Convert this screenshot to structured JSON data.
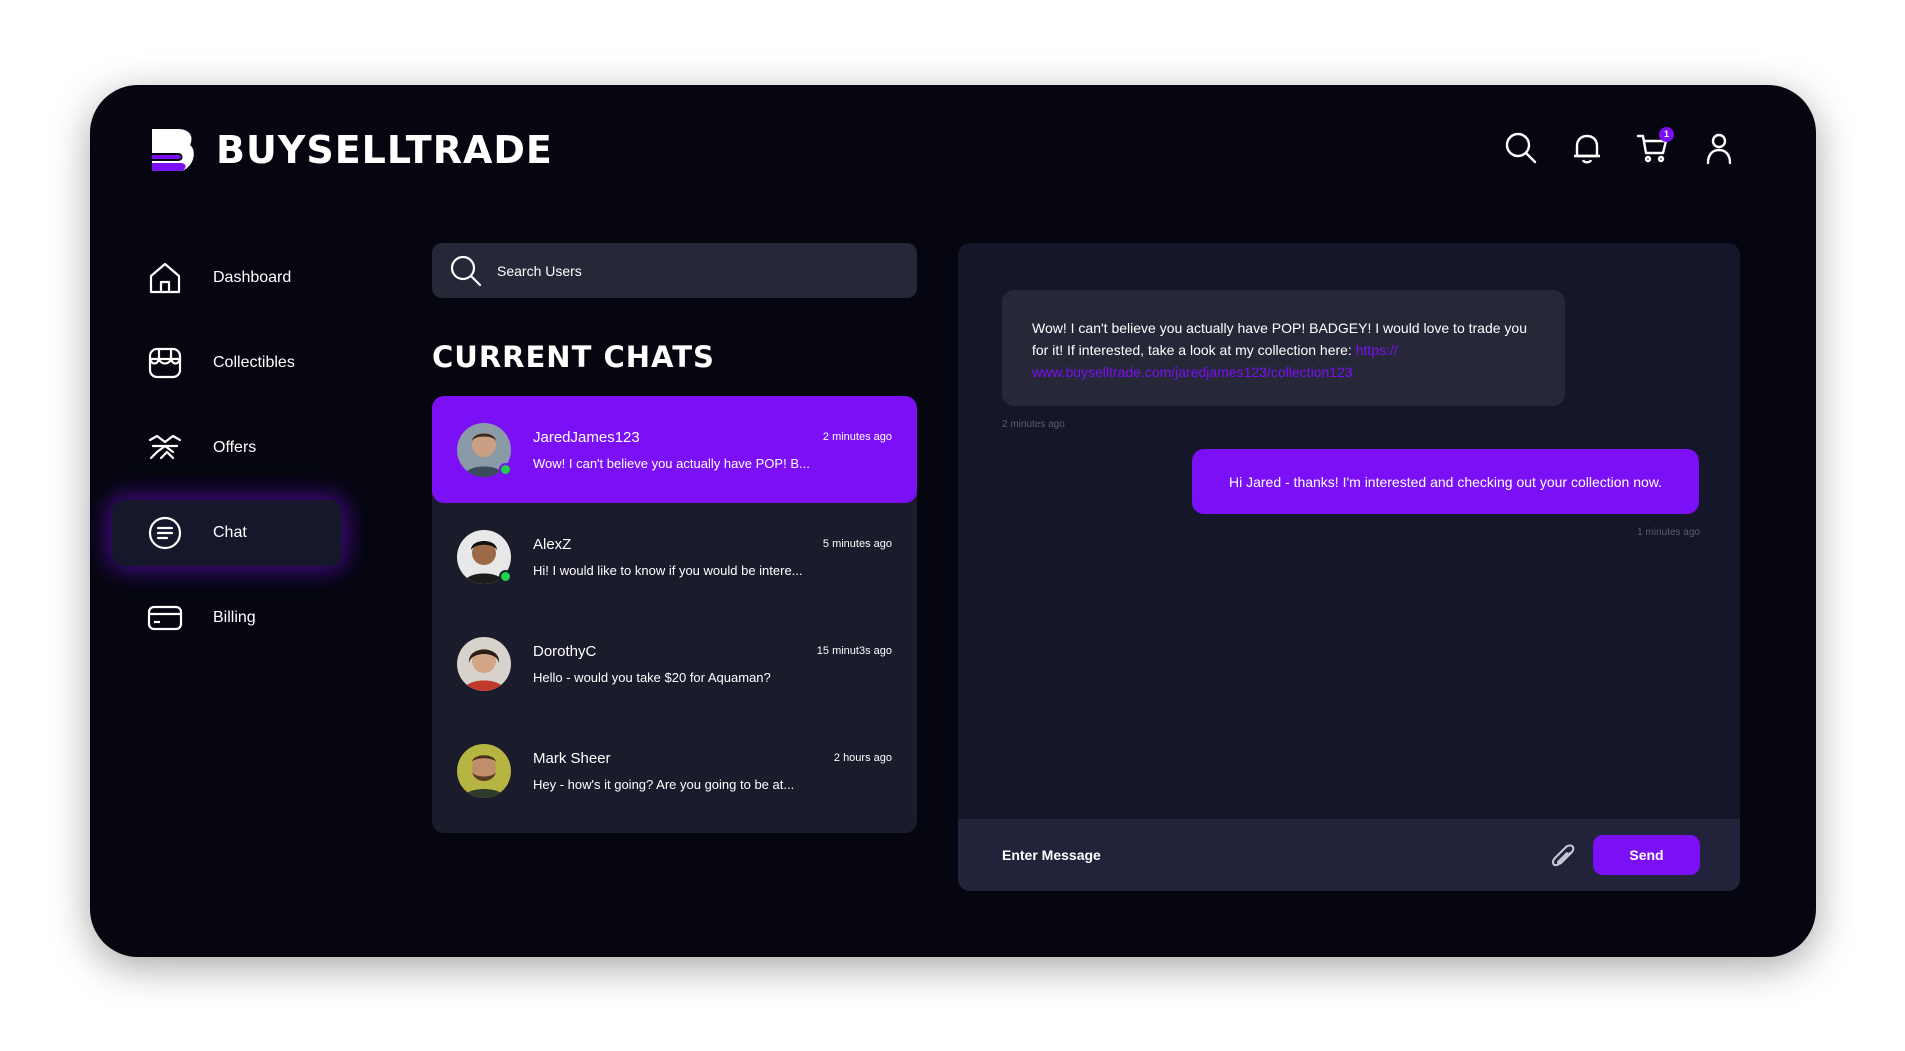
{
  "brand": {
    "name": "BUYSELLTRADE",
    "accent": "#7b0ff5",
    "background": "#05060f"
  },
  "header": {
    "icons": [
      "search-icon",
      "bell-icon",
      "cart-icon",
      "user-icon"
    ],
    "cart_count": "1"
  },
  "sidebar": {
    "items": [
      {
        "label": "Dashboard",
        "icon": "home-icon"
      },
      {
        "label": "Collectibles",
        "icon": "storefront-icon"
      },
      {
        "label": "Offers",
        "icon": "handshake-icon"
      },
      {
        "label": "Chat",
        "icon": "chat-icon",
        "active": true
      },
      {
        "label": "Billing",
        "icon": "credit-card-icon"
      }
    ]
  },
  "chats": {
    "search_placeholder": "Search Users",
    "title": "CURRENT CHATS",
    "items": [
      {
        "name": "JaredJames123",
        "time": "2 minutes ago",
        "preview": "Wow! I can't believe you actually have POP! B...",
        "online": true,
        "active": true
      },
      {
        "name": "AlexZ",
        "time": "5 minutes ago",
        "preview": "Hi! I would like to know if you would be intere...",
        "online": true
      },
      {
        "name": "DorothyC",
        "time": "15 minut3s ago",
        "preview": "Hello - would you take $20 for Aquaman?",
        "online": false
      },
      {
        "name": "Mark Sheer",
        "time": "2 hours ago",
        "preview": "Hey - how's it going? Are you going to be at...",
        "online": false
      }
    ]
  },
  "conversation": {
    "incoming": {
      "text": "Wow! I can't believe you actually have POP! BADGEY! I would love to trade you for it! If interested, take a look at my collection here: ",
      "link": "https://\nwww.buyselltrade.com/jaredjames123/collection123",
      "time": "2 minutes ago"
    },
    "outgoing": {
      "text": "Hi Jared - thanks! I'm interested and checking out your collection now.",
      "time": "1 minutes ago"
    },
    "composer": {
      "placeholder": "Enter Message",
      "send_label": "Send"
    }
  }
}
